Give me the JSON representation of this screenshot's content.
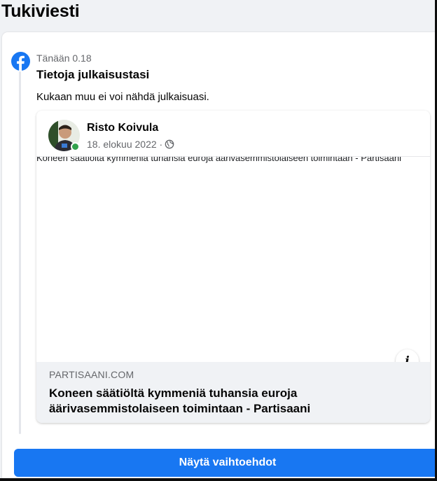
{
  "page": {
    "title": "Tukiviesti"
  },
  "message": {
    "app_icon": "facebook-icon",
    "timestamp": "Tänään 0.18",
    "heading": "Tietoja julkaisustasi",
    "body": "Kukaan muu ei voi nähdä julkaisuasi."
  },
  "post": {
    "author": "Risto Koivula",
    "date": "18. elokuu 2022 ·",
    "privacy_icon": "globe-icon",
    "preview_text": "Koneen säätiöltä kymmeniä tuhansia euroja äärivasemmistolaiseen toimintaan - Partisaani",
    "info_icon": "info-icon",
    "link": {
      "domain": "PARTISAANI.COM",
      "title": "Koneen säätiöltä kymmeniä tuhansia euroja äärivasemmistolaiseen toimintaan - Partisaani"
    }
  },
  "actions": {
    "show_options": "Näytä vaihtoehdot"
  },
  "colors": {
    "accent": "#1877f2",
    "online": "#31a24c",
    "background": "#f0f2f5"
  }
}
